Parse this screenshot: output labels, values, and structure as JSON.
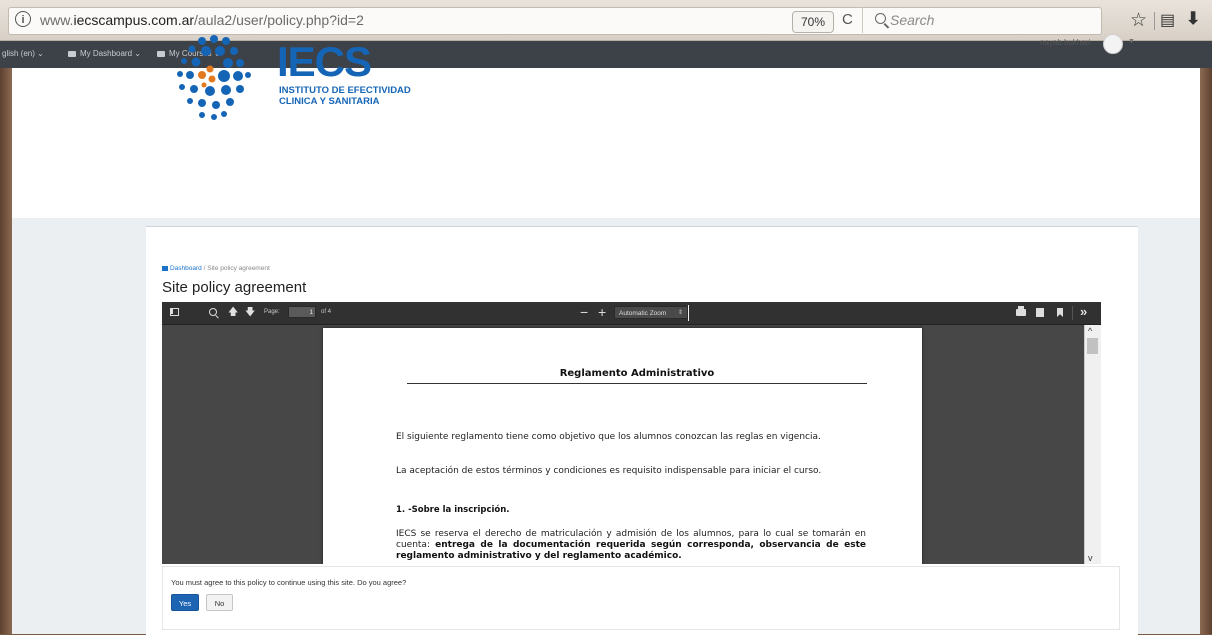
{
  "browser": {
    "url_prefix": "www.",
    "url_domain": "iecscampus.com.ar",
    "url_path": "/aula2/user/policy.php?id=2",
    "zoom": "70%",
    "search_placeholder": "Search"
  },
  "navbar": {
    "language": "glish (en)",
    "dashboard": "My Dashboard",
    "courses": "My Courses"
  },
  "header": {
    "logo_big": "IECS",
    "logo_line1": "INSTITUTO DE EFECTIVIDAD",
    "logo_line2": "CLINICA Y SANITARIA",
    "user_name": "nayab bukhari"
  },
  "breadcrumb": {
    "home": "Dashboard",
    "separator": "/",
    "current": "Site policy agreement"
  },
  "page_title": "Site policy agreement",
  "pdf": {
    "page_label": "Page:",
    "page_current": "1",
    "page_total": "of 4",
    "zoom_mode": "Automatic Zoom",
    "doc_title": "Reglamento Administrativo",
    "para1": "El siguiente reglamento tiene como objetivo que los alumnos conozcan las reglas en vigencia.",
    "para2": "La aceptación de estos términos y condiciones es requisito indispensable para iniciar el curso.",
    "heading1": "1. -Sobre la inscripción.",
    "para3_start": "IECS se reserva el derecho de matriculación y admisión de los alumnos, para lo cual se tomarán en cuenta: ",
    "para3_bold": "entrega de la documentación requerida según corresponda, observancia de este reglamento administrativo y del reglamento académico."
  },
  "agreement": {
    "question": "You must agree to this policy to continue using this site. Do you agree?",
    "yes_label": "Yes",
    "no_label": "No"
  },
  "colors": {
    "brand_blue": "#1565b6",
    "primary_button": "#1d64b3",
    "navbar": "#3d4249"
  }
}
